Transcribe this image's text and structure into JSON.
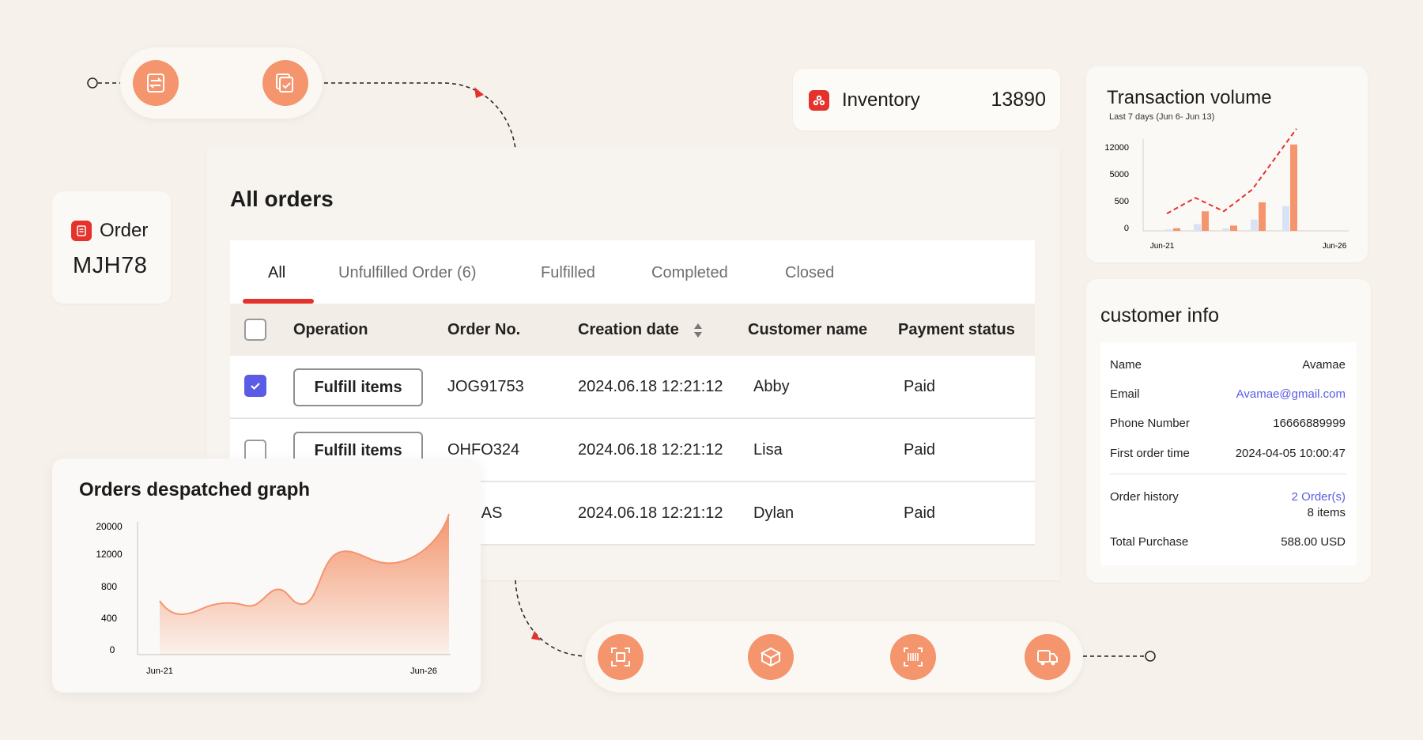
{
  "order_card": {
    "label": "Order",
    "id": "MJH78"
  },
  "inventory": {
    "label": "Inventory",
    "value": "13890"
  },
  "orders": {
    "title": "All orders",
    "tabs": [
      {
        "label": "All",
        "active": true
      },
      {
        "label": "Unfulfilled Order (6)"
      },
      {
        "label": "Fulfilled"
      },
      {
        "label": "Completed"
      },
      {
        "label": "Closed"
      }
    ],
    "columns": {
      "operation": "Operation",
      "order_no": "Order No.",
      "creation_date": "Creation date",
      "customer_name": "Customer name",
      "payment_status": "Payment status"
    },
    "rows": [
      {
        "checked": true,
        "action": "Fulfill items",
        "order_no": "JOG91753",
        "date": "2024.06.18 12:21:12",
        "customer": "Abby",
        "payment": "Paid"
      },
      {
        "checked": false,
        "action": "Fulfill items",
        "order_no": "OHFO324",
        "date": "2024.06.18 12:21:12",
        "customer": "Lisa",
        "payment": "Paid"
      },
      {
        "checked": false,
        "action": "",
        "order_no": "SDAS",
        "date": "2024.06.18 12:21:12",
        "customer": "Dylan",
        "payment": "Paid"
      }
    ]
  },
  "despatch": {
    "title": "Orders despatched graph",
    "chart_data": {
      "type": "area",
      "title": "Orders despatched graph",
      "y_ticks": [
        "20000",
        "12000",
        "800",
        "400",
        "0"
      ],
      "x_ticks": [
        "Jun-21",
        "Jun-26"
      ],
      "color": "#f4956d"
    }
  },
  "transaction": {
    "title": "Transaction volume",
    "subtitle": "Last 7 days (Jun 6- Jun 13)",
    "chart_data": {
      "type": "bar",
      "y_ticks": [
        "12000",
        "5000",
        "500",
        "0"
      ],
      "x_ticks": [
        "Jun-21",
        "Jun-26"
      ],
      "series": [
        {
          "values": [
            0.2,
            0.9,
            0.3,
            1.5,
            3.3
          ]
        },
        {
          "values": [
            0.35,
            2.6,
            0.7,
            3.8,
            11.5
          ]
        }
      ],
      "trend": [
        2.3,
        4.4,
        2.6,
        5.5,
        13.6
      ],
      "colors": {
        "light": "#d7e3f5",
        "accent": "#f4956d",
        "trend": "#e5322d"
      }
    }
  },
  "customer": {
    "title": "customer info",
    "fields": [
      {
        "key": "Name",
        "value": "Avamae"
      },
      {
        "key": "Email",
        "value": "Avamae@gmail.com"
      },
      {
        "key": "Phone Number",
        "value": "16666889999"
      },
      {
        "key": "First order time",
        "value": "2024-04-05 10:00:47"
      }
    ],
    "history": {
      "key": "Order history",
      "value": "2 Order(s)",
      "sub": "8 items"
    },
    "total": {
      "key": "Total Purchase",
      "value": "588.00 USD"
    }
  }
}
